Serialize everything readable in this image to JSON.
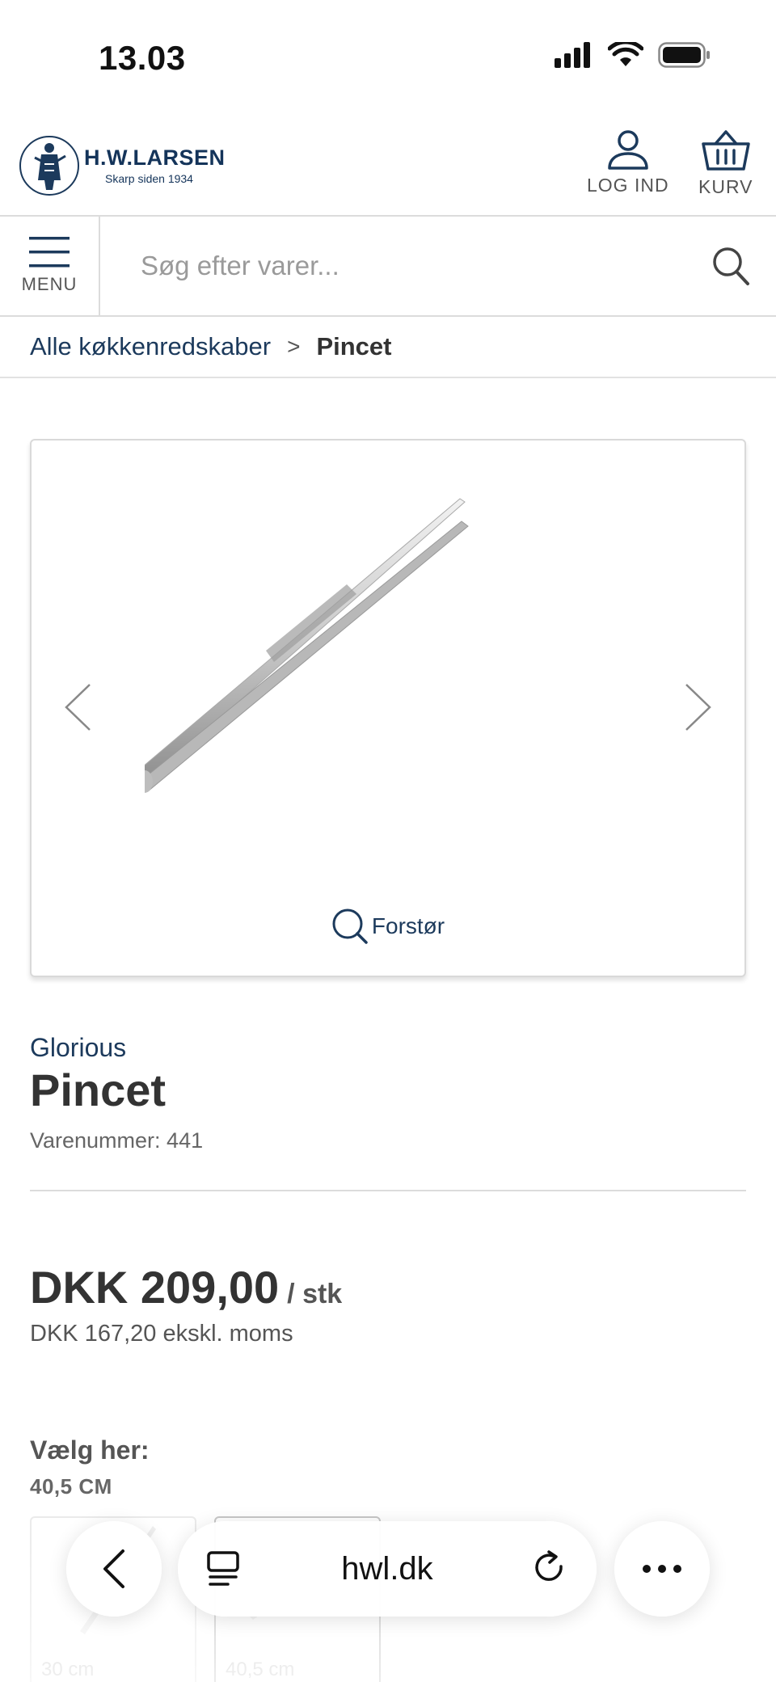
{
  "status_bar": {
    "time": "13.03"
  },
  "header": {
    "logo_name": "H.W.LARSEN",
    "logo_tagline": "Skarp siden 1934",
    "login_label": "LOG IND",
    "cart_label": "KURV"
  },
  "search": {
    "menu_label": "MENU",
    "placeholder": "Søg efter varer..."
  },
  "breadcrumb": {
    "parent": "Alle køkkenredskaber",
    "separator": ">",
    "current": "Pincet"
  },
  "gallery": {
    "zoom_label": "Forstør"
  },
  "product": {
    "brand": "Glorious",
    "title": "Pincet",
    "sku": "Varenummer: 441",
    "price": "DKK 209,00",
    "unit": "/ stk",
    "price_ex_vat": "DKK 167,20 ekskl. moms",
    "choose_label": "Vælg her:",
    "selected_variant": "40,5 CM",
    "variants": [
      {
        "label": "30 cm"
      },
      {
        "label": "40,5 cm"
      }
    ]
  },
  "browser": {
    "url": "hwl.dk"
  },
  "colors": {
    "brand_navy": "#1c3a5c",
    "text": "#333333",
    "border": "#dcdcdc"
  }
}
